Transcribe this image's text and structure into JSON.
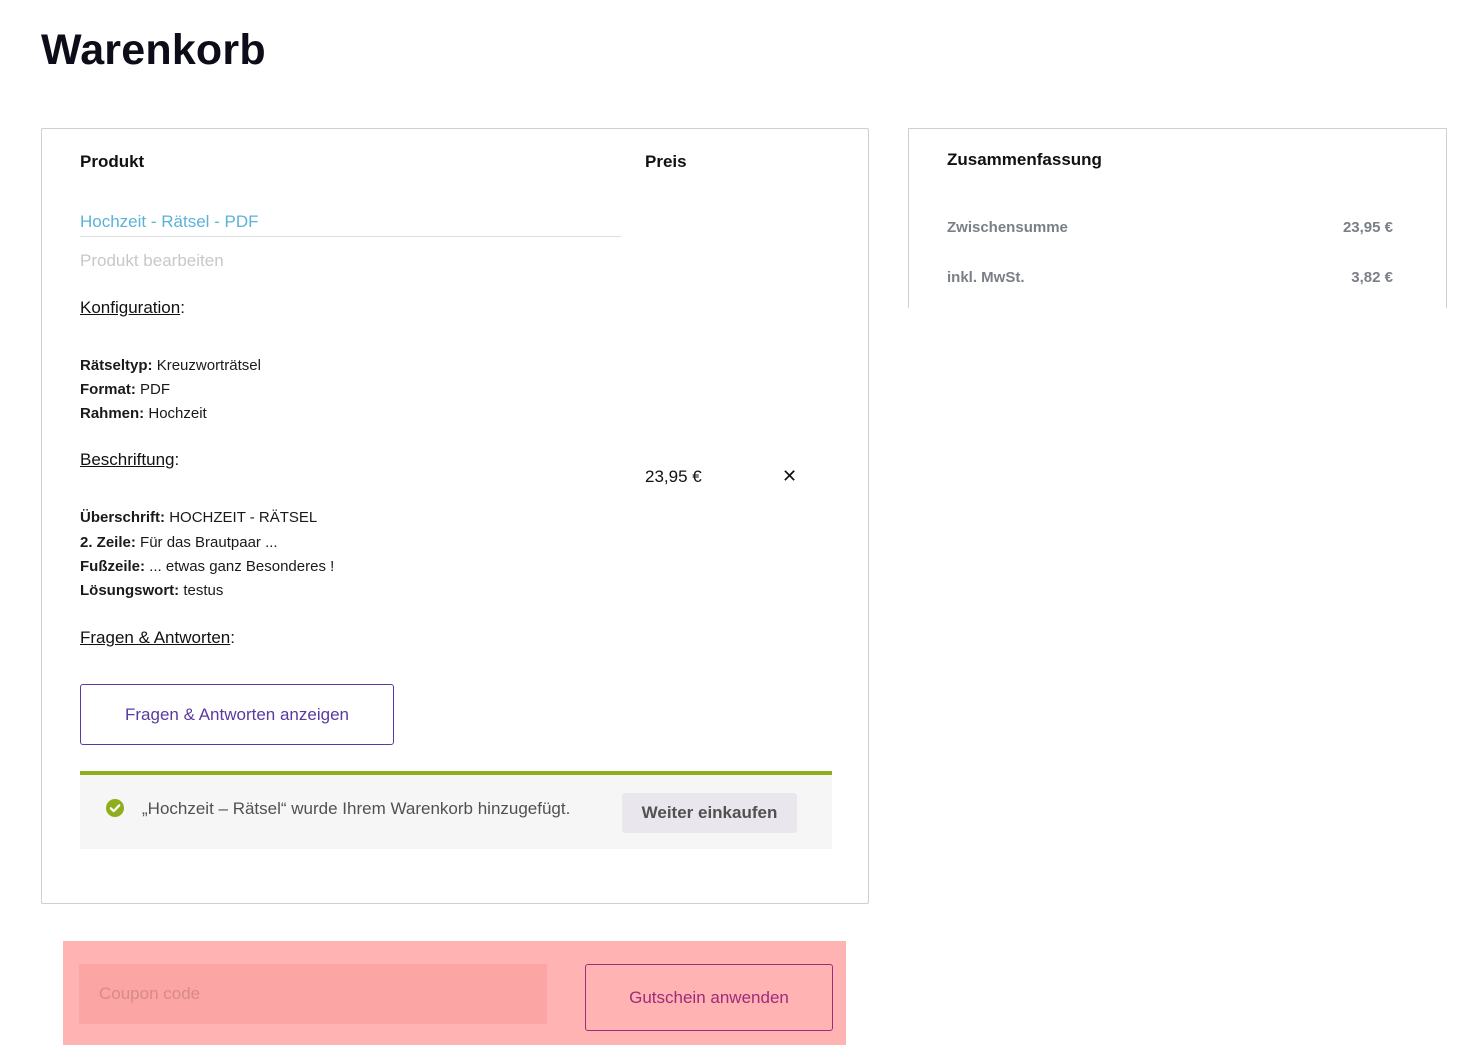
{
  "page": {
    "title": "Warenkorb"
  },
  "cart": {
    "headers": {
      "product": "Produkt",
      "price": "Preis"
    },
    "item": {
      "name": "Hochzeit - Rätsel - PDF",
      "edit_label": "Produkt bearbeiten",
      "price": "23,95 €",
      "remove_icon": "close-icon"
    },
    "configuration": {
      "title": "Konfiguration",
      "rows": [
        {
          "label": "Rätseltyp:",
          "value": "Kreuzworträtsel"
        },
        {
          "label": "Format:",
          "value": "PDF"
        },
        {
          "label": "Rahmen:",
          "value": "Hochzeit"
        }
      ]
    },
    "caption": {
      "title": "Beschriftung",
      "rows": [
        {
          "label": "Überschrift:",
          "value": "HOCHZEIT - RÄTSEL"
        },
        {
          "label": "2. Zeile:",
          "value": "Für das Brautpaar ..."
        },
        {
          "label": "Fußzeile:",
          "value": "... etwas ganz Besonderes !"
        },
        {
          "label": "Lösungswort:",
          "value": "testus"
        }
      ]
    },
    "qa": {
      "title": "Fragen & Antworten",
      "button_label": "Fragen & Antworten anzeigen"
    },
    "notice": {
      "text": "„Hochzeit – Rätsel“ wurde Ihrem Warenkorb hinzugefügt.",
      "button_label": "Weiter einkaufen",
      "icon": "check-circle-icon",
      "accent_color": "#8fae1b"
    }
  },
  "summary": {
    "title": "Zusammenfassung",
    "subtotal_label": "Zwischensumme",
    "subtotal_value": "23,95 €",
    "tax_label": "inkl. MwSt.",
    "tax_value": "3,82 €"
  },
  "coupon": {
    "placeholder": "Coupon code",
    "button_label": "Gutschein anwenden",
    "highlight_color": "#ffb3b3"
  },
  "colors": {
    "link": "#5bb3d6",
    "button_accent": "#5a3aa0",
    "coupon_accent": "#a12a7a"
  }
}
